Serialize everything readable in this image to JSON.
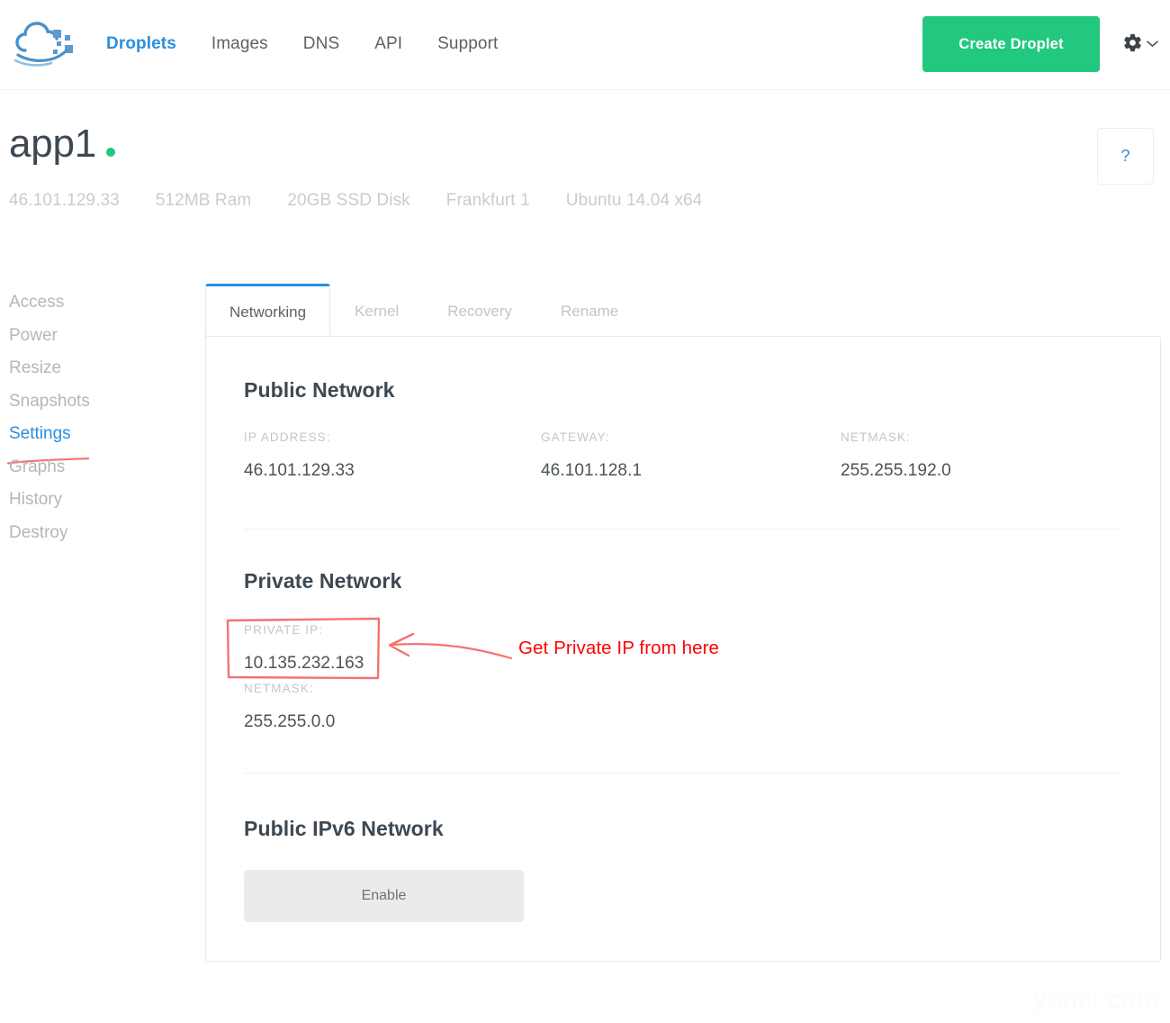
{
  "header": {
    "logo_icon": "digitalocean-cloud-logo",
    "nav": [
      {
        "label": "Droplets",
        "active": true
      },
      {
        "label": "Images",
        "active": false
      },
      {
        "label": "DNS",
        "active": false
      },
      {
        "label": "API",
        "active": false
      },
      {
        "label": "Support",
        "active": false
      }
    ],
    "create_button": "Create Droplet",
    "gear_icon": "gear-icon",
    "chevron_icon": "chevron-down-icon",
    "accent_green": "#22c87f",
    "accent_blue": "#2b8fe0"
  },
  "droplet": {
    "name": "app1",
    "status_color": "#21c87f",
    "meta": [
      "46.101.129.33",
      "512MB Ram",
      "20GB SSD Disk",
      "Frankfurt 1",
      "Ubuntu 14.04 x64"
    ],
    "help_label": "?"
  },
  "sidebar": {
    "items": [
      {
        "label": "Access",
        "active": false
      },
      {
        "label": "Power",
        "active": false
      },
      {
        "label": "Resize",
        "active": false
      },
      {
        "label": "Snapshots",
        "active": false
      },
      {
        "label": "Settings",
        "active": true
      },
      {
        "label": "Graphs",
        "active": false
      },
      {
        "label": "History",
        "active": false
      },
      {
        "label": "Destroy",
        "active": false
      }
    ]
  },
  "tabs": [
    {
      "label": "Networking",
      "active": true
    },
    {
      "label": "Kernel",
      "active": false
    },
    {
      "label": "Recovery",
      "active": false
    },
    {
      "label": "Rename",
      "active": false
    }
  ],
  "public_network": {
    "title": "Public Network",
    "ip_label": "IP ADDRESS:",
    "ip_value": "46.101.129.33",
    "gateway_label": "GATEWAY:",
    "gateway_value": "46.101.128.1",
    "netmask_label": "NETMASK:",
    "netmask_value": "255.255.192.0"
  },
  "private_network": {
    "title": "Private Network",
    "ip_label": "PRIVATE IP:",
    "ip_value": "10.135.232.163",
    "netmask_label": "NETMASK:",
    "netmask_value": "255.255.0.0"
  },
  "ipv6_network": {
    "title": "Public IPv6 Network",
    "enable_button": "Enable"
  },
  "annotation": {
    "text": "Get Private IP from here",
    "text_color": "#ff0000",
    "mark_color": "#f4736f"
  },
  "watermark": "youcl.com"
}
